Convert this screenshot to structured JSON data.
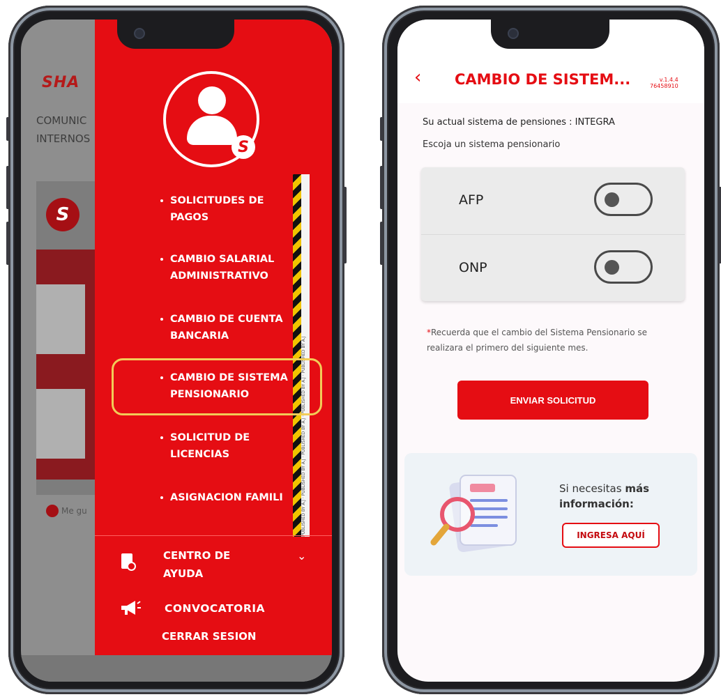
{
  "left_phone": {
    "background": {
      "logo": "SHA",
      "text_lines": [
        "COMUNIC",
        "INTERNOS"
      ],
      "like_label": "Me gu"
    },
    "drawer": {
      "menu_items": [
        {
          "line1": "SOLICITUDES DE",
          "line2": "PAGOS"
        },
        {
          "line1": "CAMBIO SALARIAL",
          "line2": "ADMINISTRATIVO"
        },
        {
          "line1": "CAMBIO DE CUENTA",
          "line2": "BANCARIA"
        },
        {
          "line1": "CAMBIO DE SISTEMA",
          "line2": "PENSIONARIO"
        },
        {
          "line1": "SOLICITUD DE",
          "line2": "LICENCIAS"
        },
        {
          "line1": "ASIGNACION FAMILI",
          "line2": ""
        }
      ],
      "highlighted_item": "CAMBIO DE SISTEMA PENSIONARIO",
      "help_center": {
        "line1": "CENTRO DE",
        "line2": "AYUDA"
      },
      "convocatoria": "CONVOCATORIA",
      "logout": "CERRAR SESION",
      "avatar_badge": "S"
    }
  },
  "right_phone": {
    "header": {
      "back_icon": "chevron-left-icon",
      "title": "CAMBIO DE SISTEM...",
      "version_line1": "v.1.4.4",
      "version_line2": "76458910"
    },
    "current_system_text": "Su actual sistema de pensiones : INTEGRA",
    "prompt_text": "Escoja un sistema pensionario",
    "options": [
      {
        "label": "AFP",
        "on": false
      },
      {
        "label": "ONP",
        "on": false
      }
    ],
    "note": {
      "star": "*",
      "text": "Recuerda que el cambio del Sistema Pensionario se realizara el primero del siguiente mes."
    },
    "submit_label": "ENVIAR SOLICITUD",
    "info": {
      "text_prefix": "Si necesitas ",
      "text_bold1": "más",
      "text_bold2": "información:",
      "button_label": "INGRESA AQUÍ"
    }
  },
  "colors": {
    "brand_red": "#e50d13",
    "highlight_yellow": "#f2cc58"
  }
}
